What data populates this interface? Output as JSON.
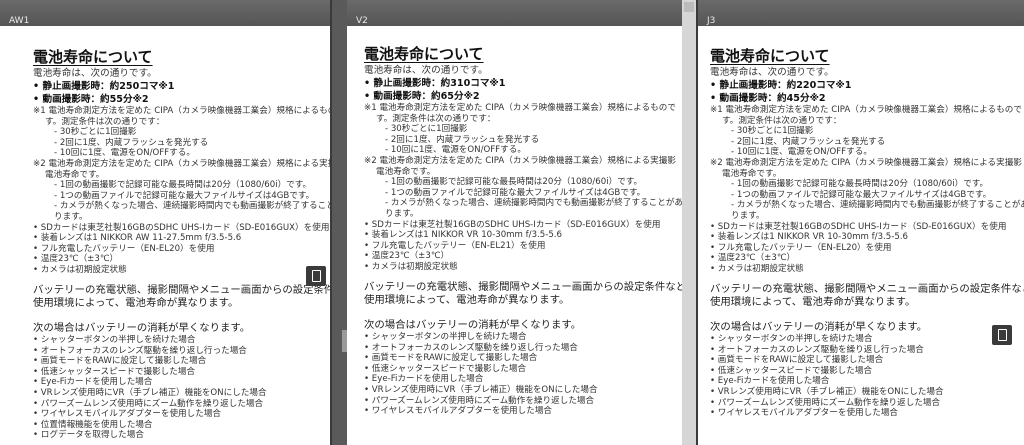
{
  "panes": [
    {
      "label": "AW1",
      "title": "電池寿命について",
      "intro": "電池寿命は、次の通りです。",
      "stat1": "• 静止画撮影時：約250コマ※1",
      "stat2": "• 動画撮影時：約55分※2",
      "notes": [
        "※1 電池寿命測定方法を定めた CIPA（カメラ映像機器工業会）規格によるもので",
        "す。測定条件は次の通りです：",
        "- 30秒ごとに1回撮影",
        "- 2回に1度、内蔵フラッシュを発光する",
        "- 10回に1度、電源をON/OFFする。",
        "※2 電池寿命測定方法を定めた CIPA（カメラ映像機器工業会）規格による実撮影",
        "電池寿命です。",
        "- 1回の動画撮影で記録可能な最長時間は20分（1080/60i）です。",
        "- 1つの動画ファイルで記録可能な最大ファイルサイズは4GBです。",
        "- カメラが熱くなった場合、連続撮影時間内でも動画撮影が終了することがあ",
        "ります。",
        "• SDカードは東芝社製16GBのSDHC UHS-Iカード（SD-E016GUX）を使用",
        "• 装着レンズは1 NIKKOR AW 11-27.5mm f/3.5-5.6",
        "• フル充電したバッテリー（EN-EL20）を使用",
        "• 温度23℃（±3℃）",
        "• カメラは初期設定状態"
      ],
      "para1a": "バッテリーの充電状態、撮影間隔やメニュー画面からの設定条件などの",
      "para1b": "使用環境によって、電池寿命が異なります。",
      "para2": "次の場合はバッテリーの消耗が早くなります。",
      "bullets": [
        "• シャッターボタンの半押しを続けた場合",
        "• オートフォーカスのレンズ駆動を繰り返し行った場合",
        "• 画質モードをRAWに設定して撮影した場合",
        "• 低速シャッタースピードで撮影した場合",
        "• Eye-Fiカードを使用した場合",
        "• VRレンズ使用時にVR（手ブレ補正）機能をONにした場合",
        "• パワーズームレンズ使用時にズーム動作を繰り返した場合",
        "• ワイヤレスモバイルアダプターを使用した場合",
        "• 位置情報機能を使用した場合",
        "• ログデータを取得した場合"
      ]
    },
    {
      "label": "V2",
      "title": "電池寿命について",
      "intro": "電池寿命は、次の通りです。",
      "stat1": "• 静止画撮影時：約310コマ※1",
      "stat2": "• 動画撮影時：約65分※2",
      "notes": [
        "※1 電池寿命測定方法を定めた CIPA（カメラ映像機器工業会）規格によるもので",
        "す。測定条件は次の通りです：",
        "- 30秒ごとに1回撮影",
        "- 2回に1度、内蔵フラッシュを発光する",
        "- 10回に1度、電源をON/OFFする。",
        "※2 電池寿命測定方法を定めた CIPA（カメラ映像機器工業会）規格による実撮影",
        "電池寿命です。",
        "- 1回の動画撮影で記録可能な最長時間は20分（1080/60i）です。",
        "- 1つの動画ファイルで記録可能な最大ファイルサイズは4GBです。",
        "- カメラが熱くなった場合、連続撮影時間内でも動画撮影が終了することがあ",
        "ります。",
        "• SDカードは東芝社製16GBのSDHC UHS-Iカード（SD-E016GUX）を使用",
        "• 装着レンズは1 NIKKOR VR 10-30mm f/3.5-5.6",
        "• フル充電したバッテリー（EN-EL21）を使用",
        "• 温度23℃（±3℃）",
        "• カメラは初期設定状態"
      ],
      "para1a": "バッテリーの充電状態、撮影間隔やメニュー画面からの設定条件などの",
      "para1b": "使用環境によって、電池寿命が異なります。",
      "para2": "次の場合はバッテリーの消耗が早くなります。",
      "bullets": [
        "• シャッターボタンの半押しを続けた場合",
        "• オートフォーカスのレンズ駆動を繰り返し行った場合",
        "• 画質モードをRAWに設定して撮影した場合",
        "• 低速シャッタースピードで撮影した場合",
        "• Eye-Fiカードを使用した場合",
        "• VRレンズ使用時にVR（手ブレ補正）機能をONにした場合",
        "• パワーズームレンズ使用時にズーム動作を繰り返した場合",
        "• ワイヤレスモバイルアダプターを使用した場合"
      ]
    },
    {
      "label": "J3",
      "title": "電池寿命について",
      "intro": "電池寿命は、次の通りです。",
      "stat1": "• 静止画撮影時：約220コマ※1",
      "stat2": "• 動画撮影時：約45分※2",
      "notes": [
        "※1 電池寿命測定方法を定めた CIPA（カメラ映像機器工業会）規格によるもので",
        "す。測定条件は次の通りです：",
        "- 30秒ごとに1回撮影",
        "- 2回に1度、内蔵フラッシュを発光する",
        "- 10回に1度、電源をON/OFFする。",
        "※2 電池寿命測定方法を定めた CIPA（カメラ映像機器工業会）規格による実撮影",
        "電池寿命です。",
        "- 1回の動画撮影で記録可能な最長時間は20分（1080/60i）です。",
        "- 1つの動画ファイルで記録可能な最大ファイルサイズは4GBです。",
        "- カメラが熱くなった場合、連続撮影時間内でも動画撮影が終了することがあ",
        "ります。",
        "• SDカードは東芝社製16GBのSDHC UHS-Iカード（SD-E016GUX）を使用",
        "• 装着レンズは1 NIKKOR VR 10-30mm f/3.5-5.6",
        "• フル充電したバッテリー（EN-EL20）を使用",
        "• 温度23℃（±3℃）",
        "• カメラは初期設定状態"
      ],
      "para1a": "バッテリーの充電状態、撮影間隔やメニュー画面からの設定条件などの",
      "para1b": "使用環境によって、電池寿命が異なります。",
      "para2": "次の場合はバッテリーの消耗が早くなります。",
      "bullets": [
        "• シャッターボタンの半押しを続けた場合",
        "• オートフォーカスのレンズ駆動を繰り返し行った場合",
        "• 画質モードをRAWに設定して撮影した場合",
        "• 低速シャッタースピードで撮影した場合",
        "• Eye-Fiカードを使用した場合",
        "• VRレンズ使用時にVR（手ブレ補正）機能をONにした場合",
        "• パワーズームレンズ使用時にズーム動作を繰り返した場合",
        "• ワイヤレスモバイルアダプターを使用した場合"
      ]
    }
  ]
}
